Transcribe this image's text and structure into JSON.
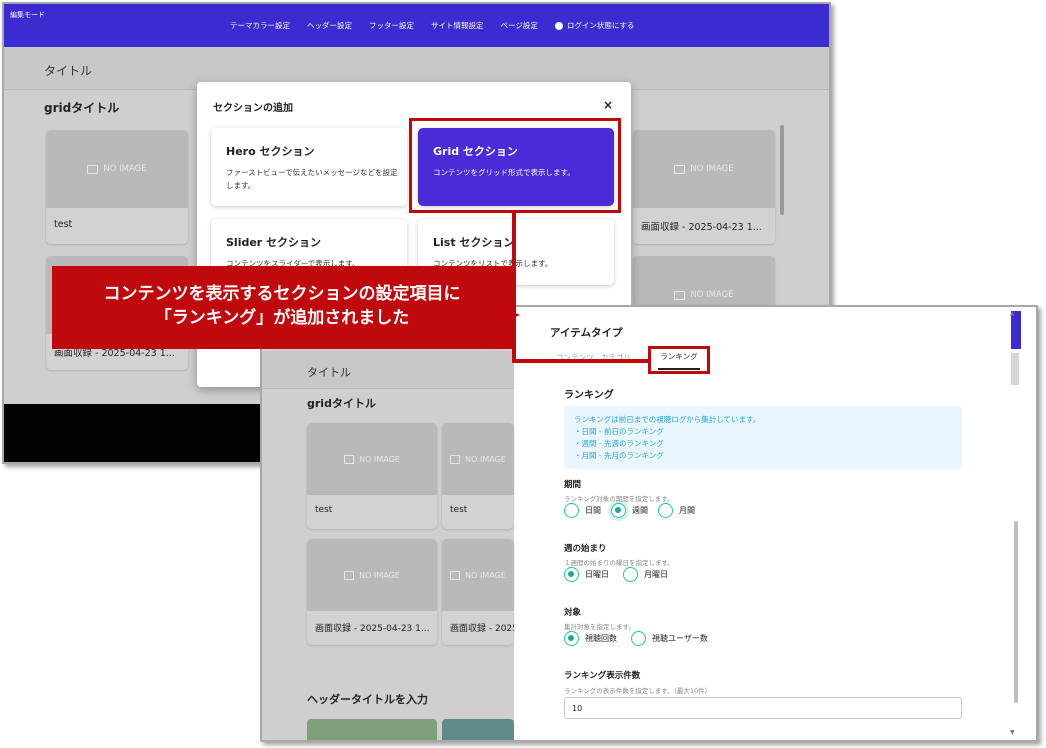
{
  "back": {
    "mode_label": "編集モード",
    "nav": [
      "テーマカラー設定",
      "ヘッダー設定",
      "フッター設定",
      "サイト情報設定",
      "ページ設定"
    ],
    "login_label": "ログイン状態にする",
    "page_title": "タイトル",
    "grid_title": "gridタイトル",
    "no_image": "NO IMAGE",
    "cards": [
      "test",
      "画面収録 - 2025-04-23 1...",
      "画面収録 - 2025-04-23 1..."
    ]
  },
  "modal": {
    "title": "セクションの追加",
    "close": "×",
    "sections": [
      {
        "title": "Hero セクション",
        "desc": "ファーストビューで伝えたいメッセージなどを設定します。"
      },
      {
        "title": "Grid セクション",
        "desc": "コンテンツをグリッド形式で表示します。"
      },
      {
        "title": "Slider セクション",
        "desc": "コンテンツをスライダーで表示します。"
      },
      {
        "title": "List セクション",
        "desc": "コンテンツをリストで表示します。"
      }
    ]
  },
  "callout": {
    "line1": "コンテンツを表示するセクションの設定項目に",
    "line2": "「ランキング」が追加されました"
  },
  "front": {
    "page_title": "タイトル",
    "grid_title": "gridタイトル",
    "no_image": "NO IMAGE",
    "cards": [
      "test",
      "test",
      "画面収録 - 2025-04-23 1...",
      "画面収録 - 2025"
    ],
    "header_title_placeholder": "ヘッダータイトルを入力",
    "panel": {
      "item_type_label": "アイテムタイプ",
      "tabs_hidden": "コンテンツ　カテゴリ",
      "active_tab": "ランキング",
      "ranking_heading": "ランキング",
      "info_lines": [
        "ランキングは前日までの視聴ログから集計しています。",
        "・日間 - 前日のランキング",
        "・週間 - 先週のランキング",
        "・月間 - 先月のランキング"
      ],
      "period": {
        "label": "期間",
        "desc": "ランキング対象の期間を指定します。",
        "options": [
          "日間",
          "週間",
          "月間"
        ],
        "selected": "週間"
      },
      "week_start": {
        "label": "週の始まり",
        "desc": "１週間の始まりの曜日を指定します。",
        "options": [
          "日曜日",
          "月曜日"
        ],
        "selected": "日曜日"
      },
      "target": {
        "label": "対象",
        "desc": "集計対象を指定します。",
        "options": [
          "視聴回数",
          "視聴ユーザー数"
        ],
        "selected": "視聴回数"
      },
      "count": {
        "label": "ランキング表示件数",
        "desc": "ランキングの表示件数を指定します。（最大10件）",
        "value": "10"
      }
    }
  },
  "colors": {
    "brand_blue": "#3c2bd1",
    "grid_selected": "#4b2bd8",
    "annotation_red": "#c0090c",
    "radio_teal": "#20c6a6",
    "info_text": "#2aa3d8"
  }
}
